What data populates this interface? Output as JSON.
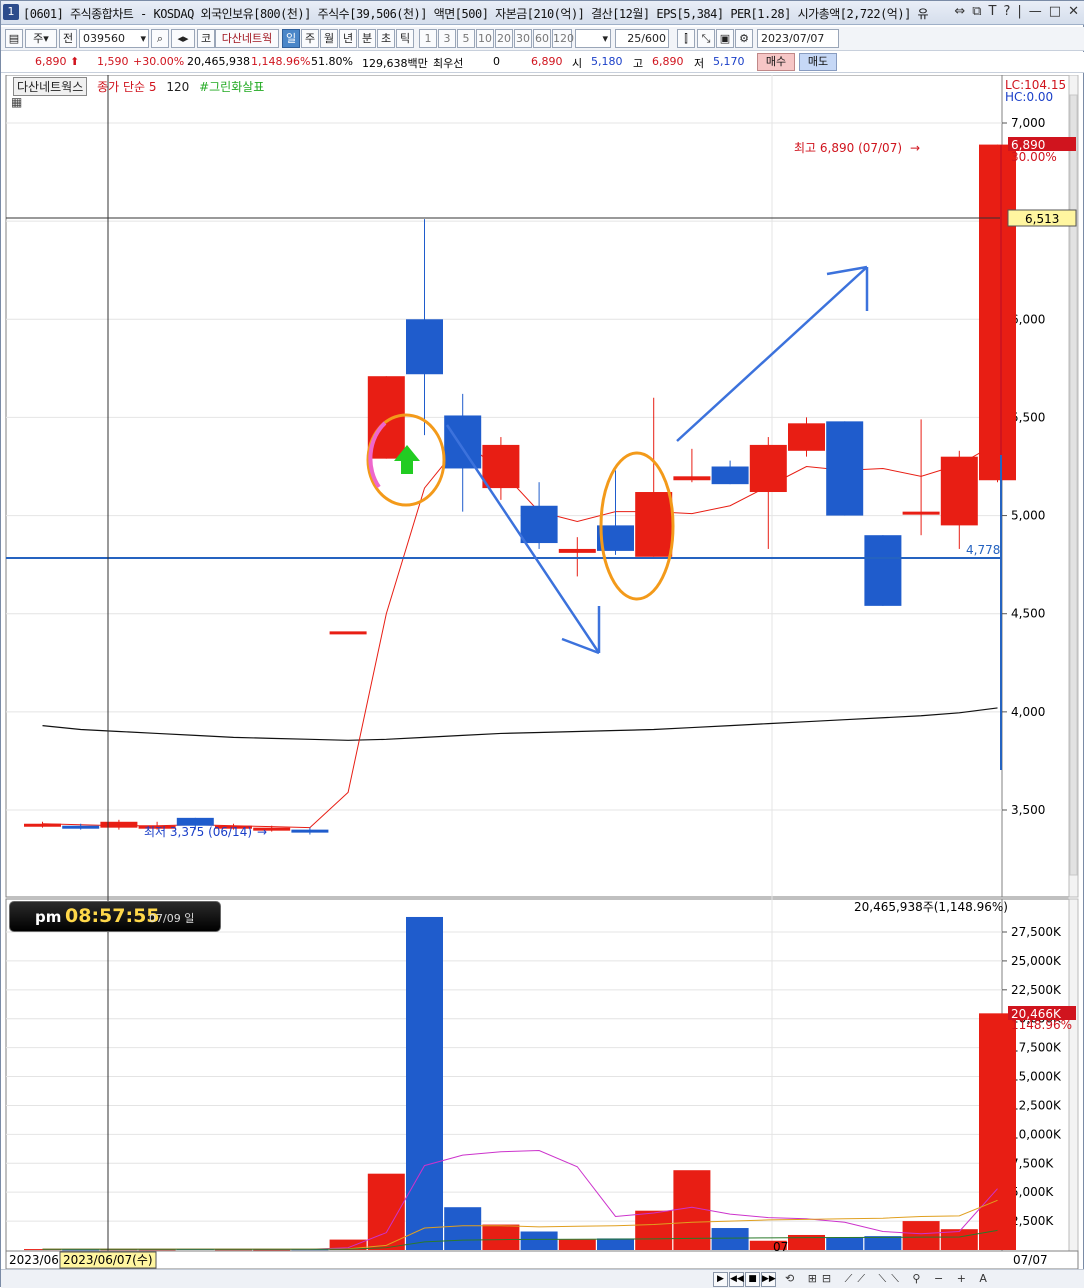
{
  "title": {
    "num": "1",
    "text": "[0601] 주식종합차트 - KOSDAQ 외국인보유[800(천)] 주식수[39,506(천)] 액면[500] 자본금[210(억)] 결산[12월] EPS[5,384] PER[1.28] 시가총액[2,722(억)] 유",
    "window_icons": [
      "⇔",
      "⧉",
      "T",
      "?",
      "|",
      "—",
      "□",
      "✕"
    ]
  },
  "toolbar": {
    "kind": "주",
    "all": "전",
    "code": "039560",
    "market": "코",
    "name": "다산네트웍",
    "periods": [
      "일",
      "주",
      "월",
      "년",
      "분",
      "초",
      "틱"
    ],
    "selected_period": "일",
    "intervals": [
      "1",
      "3",
      "5",
      "10",
      "20",
      "30",
      "60",
      "120"
    ],
    "count": "25",
    "count_total": "/600",
    "date": "2023/07/07"
  },
  "quote": {
    "price": "6,890",
    "change": "1,590",
    "change_pct": "+30.00%",
    "volume": "20,465,938",
    "volume_pct": "1,148.96%",
    "ratio": "51.80%",
    "amount": "129,638백만",
    "best_label": "최우선",
    "best_value": "0",
    "best_price": "6,890",
    "open_label": "시",
    "open": "5,180",
    "high_label": "고",
    "high": "6,890",
    "low_label": "저",
    "low": "5,170",
    "buy": "매수",
    "sell": "매도"
  },
  "legend": {
    "name": "다산네트웍스",
    "ma": "종가 단순 5",
    "ma2": "120",
    "signal": "#그린화살표"
  },
  "price_axis": {
    "lc": "LC:104.15",
    "hc": "HC:0.00",
    "ticks": [
      "7,000",
      "6,500",
      "6,000",
      "5,500",
      "5,000",
      "4,500",
      "4,000",
      "3,500"
    ],
    "last_price": "6,890",
    "last_pct": "30.00%",
    "crosshair_price": "6,513",
    "hline_price": "4,778"
  },
  "annotations": {
    "high": "최고 6,890 (07/07)",
    "low": "최저 3,375 (06/14)"
  },
  "volume_axis": {
    "header": "20,465,938주(1,148.96%)",
    "ticks": [
      "27,500K",
      "25,000K",
      "22,500K",
      "20,000K",
      "17,500K",
      "15,000K",
      "12,500K",
      "10,000K",
      "7,500K",
      "5,000K",
      "2,500K"
    ],
    "last": "20,466K",
    "last_pct": "1148.96%"
  },
  "clock": {
    "ampm": "pm",
    "time": "08:57:55",
    "date": "07/09 일"
  },
  "date_axis": {
    "left": "2023/06",
    "crosshair_date": "2023/06/07(수)",
    "mid": "07",
    "right": "07/07"
  },
  "chart_data": {
    "type": "candlestick",
    "price_ylim": [
      3200,
      7100
    ],
    "volume_ylim": [
      0,
      28500
    ],
    "candles": [
      {
        "o": 3430,
        "h": 3440,
        "l": 3410,
        "c": 3420,
        "up": true
      },
      {
        "o": 3420,
        "h": 3430,
        "l": 3400,
        "c": 3410,
        "up": false
      },
      {
        "o": 3410,
        "h": 3450,
        "l": 3400,
        "c": 3440,
        "up": true
      },
      {
        "o": 3420,
        "h": 3440,
        "l": 3400,
        "c": 3410,
        "up": true
      },
      {
        "o": 3460,
        "h": 3460,
        "l": 3400,
        "c": 3420,
        "up": false
      },
      {
        "o": 3420,
        "h": 3430,
        "l": 3400,
        "c": 3410,
        "up": true
      },
      {
        "o": 3410,
        "h": 3420,
        "l": 3390,
        "c": 3400,
        "up": true
      },
      {
        "o": 3400,
        "h": 3410,
        "l": 3375,
        "c": 3390,
        "up": false
      },
      {
        "o": 4410,
        "h": 4410,
        "l": 4410,
        "c": 4410,
        "up": true
      },
      {
        "o": 5290,
        "h": 5710,
        "l": 5290,
        "c": 5710,
        "up": true
      },
      {
        "o": 6000,
        "h": 6510,
        "l": 5410,
        "c": 5720,
        "up": false
      },
      {
        "o": 5510,
        "h": 5620,
        "l": 5020,
        "c": 5240,
        "up": false
      },
      {
        "o": 5360,
        "h": 5400,
        "l": 5080,
        "c": 5140,
        "up": true
      },
      {
        "o": 5050,
        "h": 5170,
        "l": 4830,
        "c": 4860,
        "up": false
      },
      {
        "o": 4810,
        "h": 4890,
        "l": 4690,
        "c": 4830,
        "up": true
      },
      {
        "o": 4950,
        "h": 5230,
        "l": 4800,
        "c": 4820,
        "up": false
      },
      {
        "o": 5120,
        "h": 5600,
        "l": 4790,
        "c": 4790,
        "up": true
      },
      {
        "o": 5180,
        "h": 5340,
        "l": 5170,
        "c": 5200,
        "up": true
      },
      {
        "o": 5250,
        "h": 5280,
        "l": 5160,
        "c": 5160,
        "up": false
      },
      {
        "o": 5360,
        "h": 5400,
        "l": 4830,
        "c": 5120,
        "up": true
      },
      {
        "o": 5470,
        "h": 5500,
        "l": 5300,
        "c": 5330,
        "up": true
      },
      {
        "o": 5480,
        "h": 5480,
        "l": 5000,
        "c": 5000,
        "up": false
      },
      {
        "o": 4900,
        "h": 4900,
        "l": 4540,
        "c": 4540,
        "up": false
      },
      {
        "o": 5020,
        "h": 5490,
        "l": 4900,
        "c": 5010,
        "up": true
      },
      {
        "o": 5300,
        "h": 5330,
        "l": 4830,
        "c": 4950,
        "up": true
      },
      {
        "o": 6890,
        "h": 6890,
        "l": 5170,
        "c": 5180,
        "up": true
      }
    ],
    "ma5": [
      3430,
      3425,
      3420,
      3420,
      3425,
      3420,
      3415,
      3410,
      3590,
      4500,
      5140,
      5380,
      5230,
      5020,
      4970,
      5020,
      5020,
      5010,
      5050,
      5150,
      5250,
      5230,
      5240,
      5200,
      5260,
      5370
    ],
    "ma120": [
      3930,
      3910,
      3900,
      3890,
      3880,
      3870,
      3865,
      3860,
      3855,
      3860,
      3870,
      3880,
      3890,
      3895,
      3900,
      3905,
      3910,
      3920,
      3930,
      3940,
      3950,
      3960,
      3970,
      3980,
      3995,
      4020
    ],
    "volumes": [
      80,
      60,
      70,
      60,
      90,
      60,
      50,
      70,
      900,
      6600,
      28800,
      3700,
      2200,
      1600,
      900,
      1000,
      3400,
      6900,
      1900,
      800,
      1300,
      1100,
      1200,
      2500,
      1800,
      20466
    ],
    "vol_ma_a": [
      80,
      80,
      80,
      80,
      80,
      80,
      70,
      70,
      200,
      1500,
      7300,
      8200,
      8500,
      8600,
      7200,
      2900,
      3200,
      3700,
      3100,
      2800,
      2700,
      2400,
      1600,
      1400,
      1600,
      5300
    ],
    "vol_ma_b": [
      80,
      80,
      80,
      80,
      80,
      80,
      80,
      80,
      100,
      400,
      1900,
      2100,
      2100,
      2000,
      2050,
      2100,
      2200,
      2400,
      2500,
      2600,
      2650,
      2700,
      2750,
      2900,
      2950,
      4300
    ],
    "vol_ma_c": [
      60,
      60,
      60,
      60,
      60,
      60,
      60,
      60,
      70,
      200,
      700,
      850,
      900,
      920,
      930,
      940,
      960,
      1000,
      1030,
      1050,
      1070,
      1080,
      1090,
      1110,
      1120,
      1700
    ]
  }
}
